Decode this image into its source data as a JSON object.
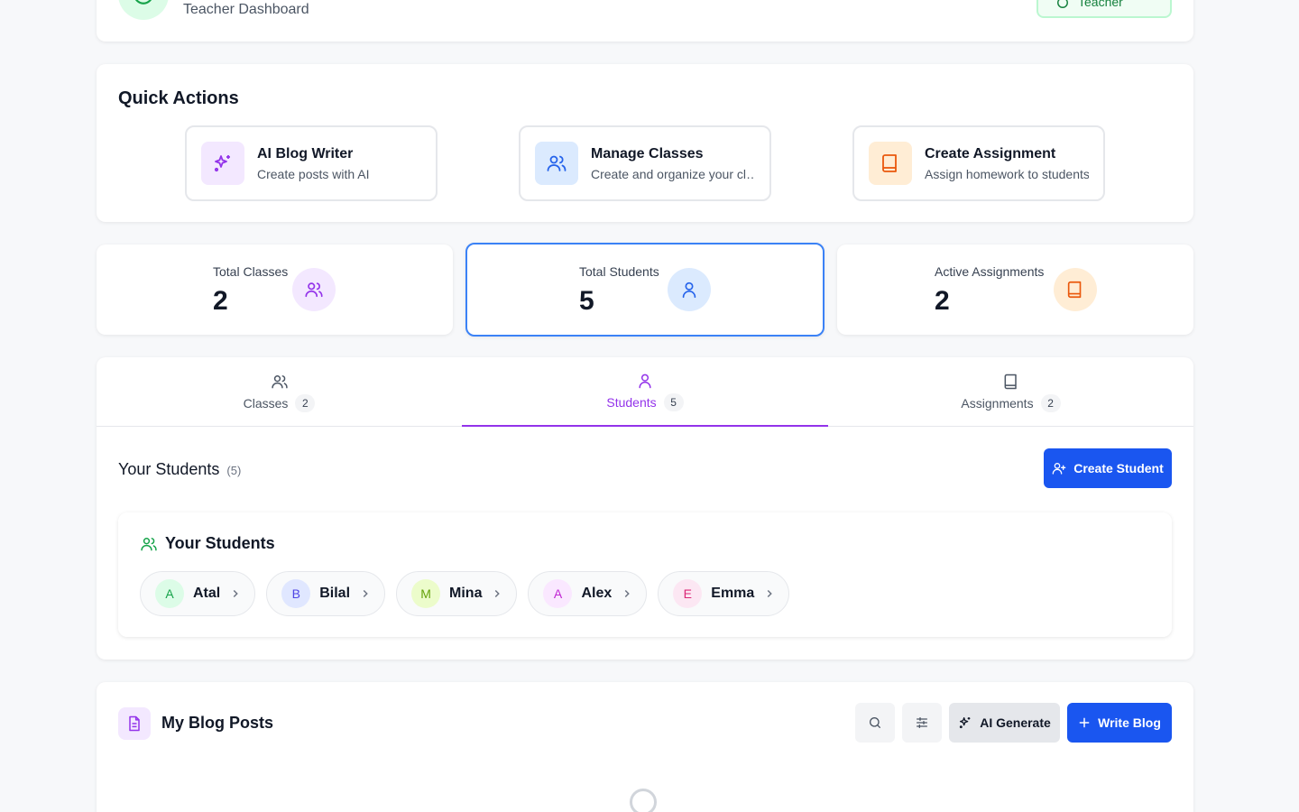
{
  "header": {
    "subtitle": "Teacher Dashboard",
    "role_badge": "Teacher"
  },
  "quick_actions": {
    "title": "Quick Actions",
    "items": [
      {
        "label": "AI Blog Writer",
        "desc": "Create posts with AI",
        "icon": "sparkles-icon"
      },
      {
        "label": "Manage Classes",
        "desc": "Create and organize your classes",
        "icon": "users-icon"
      },
      {
        "label": "Create Assignment",
        "desc": "Assign homework to students",
        "icon": "book-icon"
      }
    ]
  },
  "stats": [
    {
      "label": "Total Classes",
      "value": "2",
      "icon": "users-icon"
    },
    {
      "label": "Total Students",
      "value": "5",
      "icon": "user-icon"
    },
    {
      "label": "Active Assignments",
      "value": "2",
      "icon": "book-icon"
    }
  ],
  "tabs": [
    {
      "label": "Classes",
      "count": "2",
      "icon": "users-icon"
    },
    {
      "label": "Students",
      "count": "5",
      "icon": "user-icon"
    },
    {
      "label": "Assignments",
      "count": "2",
      "icon": "book-icon"
    }
  ],
  "students_section": {
    "title": "Your Students",
    "count": "(5)",
    "create_label": "Create Student",
    "panel_title": "Your Students",
    "students": [
      {
        "initial": "A",
        "name": "Atal",
        "color": "#16a34a",
        "bg": "#dcfce7"
      },
      {
        "initial": "B",
        "name": "Bilal",
        "color": "#4f46e5",
        "bg": "#e0e7ff"
      },
      {
        "initial": "M",
        "name": "Mina",
        "color": "#65a30d",
        "bg": "#ecfccb"
      },
      {
        "initial": "A",
        "name": "Alex",
        "color": "#c026d3",
        "bg": "#fae8ff"
      },
      {
        "initial": "E",
        "name": "Emma",
        "color": "#db2777",
        "bg": "#fce7f3"
      }
    ]
  },
  "blog": {
    "title": "My Blog Posts",
    "ai_label": "AI Generate",
    "write_label": "Write Blog"
  },
  "colors": {
    "accent_purple": "#9333ea",
    "primary_blue": "#1a56f0",
    "active_border": "#3b82f6"
  }
}
